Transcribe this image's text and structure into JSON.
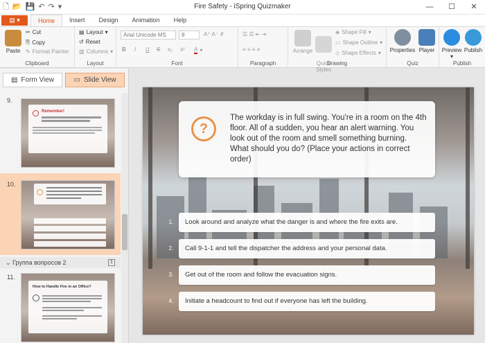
{
  "window": {
    "title": "Fire Safety - iSpring Quizmaker"
  },
  "file_button": "",
  "tabs": [
    "Home",
    "Insert",
    "Design",
    "Animation",
    "Help"
  ],
  "ribbon": {
    "clipboard": {
      "paste": "Paste",
      "cut": "Cut",
      "copy": "Copy",
      "format_painter": "Format Painter",
      "label": "Clipboard"
    },
    "layout": {
      "layout": "Layout",
      "reset": "Reset",
      "columns": "Columns",
      "label": "Layout"
    },
    "font": {
      "family": "Arial Unicode MS",
      "size": "8",
      "bold": "B",
      "italic": "I",
      "underline": "U",
      "strike": "S",
      "sub": "x₂",
      "sup": "x²",
      "color": "A",
      "label": "Font"
    },
    "paragraph": {
      "label": "Paragraph"
    },
    "drawing": {
      "arrange": "Arrange",
      "quick_styles": "Quick\nStyles",
      "shape_fill": "Shape Fill",
      "shape_outline": "Shape Outline",
      "shape_effects": "Shape Effects",
      "label": "Drawing"
    },
    "quiz": {
      "properties": "Properties",
      "player": "Player",
      "label": "Quiz"
    },
    "publish": {
      "preview": "Preview",
      "publish": "Publish",
      "label": "Publish"
    }
  },
  "view": {
    "form_view": "Form View",
    "slide_view": "Slide View"
  },
  "slides": [
    {
      "num": "9.",
      "title": "Remember!"
    },
    {
      "num": "10."
    },
    {
      "group": "Группа вопросов 2",
      "count": "1"
    },
    {
      "num": "11.",
      "title": "How to Handle Fire in an Office?"
    }
  ],
  "question": {
    "text": "The workday is in full swing. You're in a room on the 4th floor. All of a sudden, you hear an alert warning. You look out of the room and smell something burning. What should you do? (Place your actions in correct order)",
    "answers": [
      {
        "n": "1.",
        "text": "Look around and analyze what the danger is and where the fire exits are."
      },
      {
        "n": "2.",
        "text": "Call 9-1-1 and tell the dispatcher the address and your personal data."
      },
      {
        "n": "3.",
        "text": "Get out of the room and follow the evacuation signs."
      },
      {
        "n": "4.",
        "text": "Initiate a headcount to find out if everyone has left the building."
      }
    ]
  },
  "colors": {
    "accent": "#e4571b",
    "selection": "#fbd4b5",
    "question_icon": "#e9934a"
  }
}
